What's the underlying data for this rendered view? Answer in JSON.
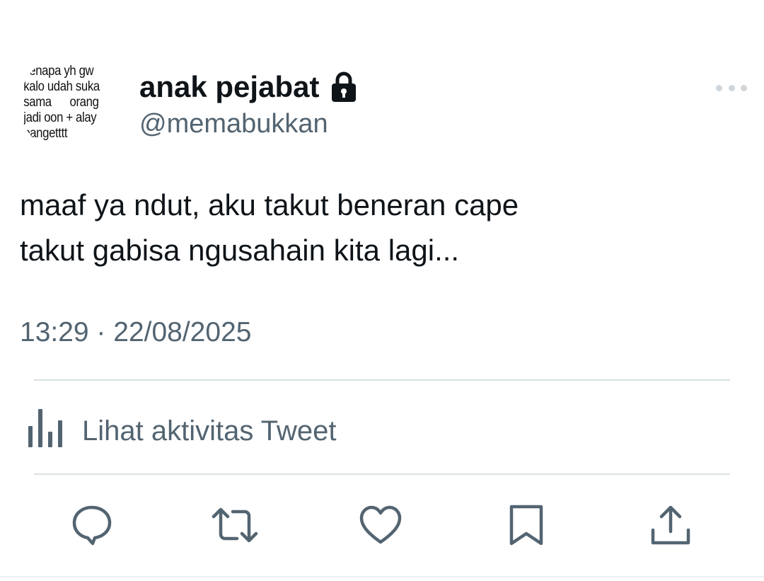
{
  "tweet": {
    "avatar": {
      "text_lines": [
        "kenapa yh gw",
        "kalo udah suka",
        "sama      orang",
        "jadi oon + alay",
        "bangetttt"
      ]
    },
    "author": {
      "display_name": "anak pejabat",
      "handle": "@memabukkan",
      "protected_icon": "lock-icon"
    },
    "more_icon": "more-horizontal-icon",
    "text_lines": [
      "maaf ya ndut, aku takut beneran cape",
      "takut gabisa ngusahain kita lagi..."
    ],
    "timestamp": "13:29 · 22/08/2025",
    "activity": {
      "icon": "analytics-bars-icon",
      "label": "Lihat aktivitas Tweet"
    },
    "actions": [
      {
        "name": "reply",
        "icon": "reply-icon"
      },
      {
        "name": "retweet",
        "icon": "retweet-icon"
      },
      {
        "name": "like",
        "icon": "heart-icon"
      },
      {
        "name": "bookmark",
        "icon": "bookmark-icon"
      },
      {
        "name": "share",
        "icon": "share-icon"
      }
    ]
  },
  "colors": {
    "primary_text": "#0f1419",
    "secondary_text": "#536471",
    "divider": "#d9e0e3",
    "icon": "#536471"
  }
}
